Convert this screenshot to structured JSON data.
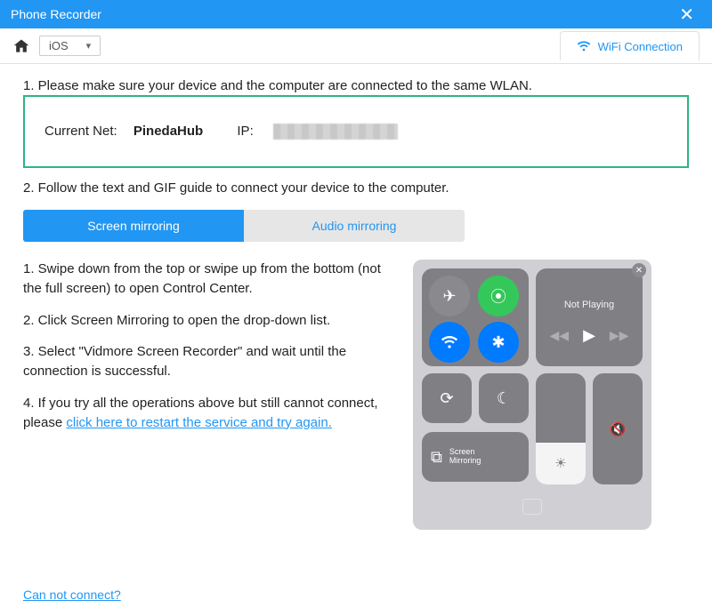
{
  "title": "Phone Recorder",
  "toolbar": {
    "os_selected": "iOS",
    "wifi_tab": "WiFi Connection"
  },
  "steps": {
    "s1": "1. Please make sure your device and the computer are connected to the same WLAN.",
    "net_label": "Current Net:",
    "net_name": "PinedaHub",
    "ip_label": "IP:",
    "s2": "2. Follow the text and GIF guide to connect your device to the computer."
  },
  "tabs": {
    "screen": "Screen mirroring",
    "audio": "Audio mirroring"
  },
  "instructions": {
    "i1": "1. Swipe down from the top or swipe up from the bottom (not the full screen) to open Control Center.",
    "i2": "2. Click Screen Mirroring to open the drop-down list.",
    "i3": "3. Select \"Vidmore Screen Recorder\" and wait until the connection is successful.",
    "i4a": "4. If you try all the operations above but still cannot connect, please ",
    "i4link": "click here to restart the service and try again."
  },
  "control_center": {
    "not_playing": "Not Playing",
    "screen_mirroring": "Screen\nMirroring"
  },
  "footer": {
    "cannot_connect": "Can not connect?"
  }
}
